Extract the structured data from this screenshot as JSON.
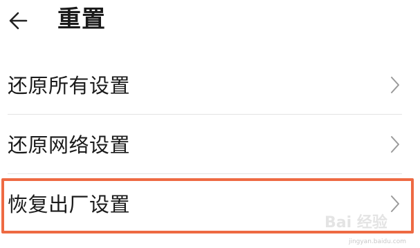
{
  "header": {
    "title": "重置",
    "back_icon": "arrow-left-icon"
  },
  "menu": {
    "items": [
      {
        "label": "还原所有设置",
        "icon": "chevron-right-icon"
      },
      {
        "label": "还原网络设置",
        "icon": "chevron-right-icon"
      },
      {
        "label": "恢复出厂设置",
        "icon": "chevron-right-icon",
        "highlighted": true
      }
    ]
  },
  "watermark": {
    "logo_text": "Bai 经验",
    "url": "jingyan.baidu.com"
  },
  "colors": {
    "highlight": "#ee6a43",
    "divider": "#e3e3e3",
    "chevron": "#9a9a9a"
  }
}
